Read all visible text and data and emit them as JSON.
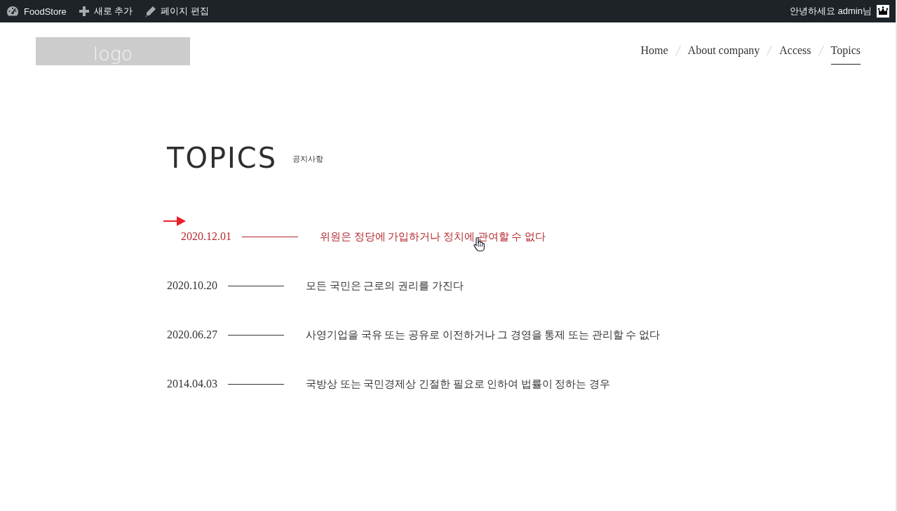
{
  "admin_bar": {
    "site_name": "FoodStore",
    "new_item": "새로 추가",
    "edit_page": "페이지 편집",
    "greeting": "안녕하세요 admin님"
  },
  "header": {
    "logo": "logo",
    "nav": [
      {
        "label": "Home",
        "selected": false
      },
      {
        "label": "About company",
        "selected": false
      },
      {
        "label": "Access",
        "selected": false
      },
      {
        "label": "Topics",
        "selected": true
      }
    ]
  },
  "topics": {
    "title": "TOPICS",
    "subtitle": "공지사항",
    "items": [
      {
        "date": "2020.12.01",
        "title": "위원은 정당에 가입하거나 정치에 관여할 수 없다",
        "hovered": true
      },
      {
        "date": "2020.10.20",
        "title": "모든 국민은 근로의 권리를 가진다",
        "hovered": false
      },
      {
        "date": "2020.06.27",
        "title": "사영기업을 국유 또는 공유로 이전하거나 그 경영을 통제 또는 관리할 수 없다",
        "hovered": false
      },
      {
        "date": "2014.04.03",
        "title": "국방상 또는 국민경제상 긴절한 필요로 인하여 법률이 정하는 경우",
        "hovered": false
      }
    ]
  }
}
